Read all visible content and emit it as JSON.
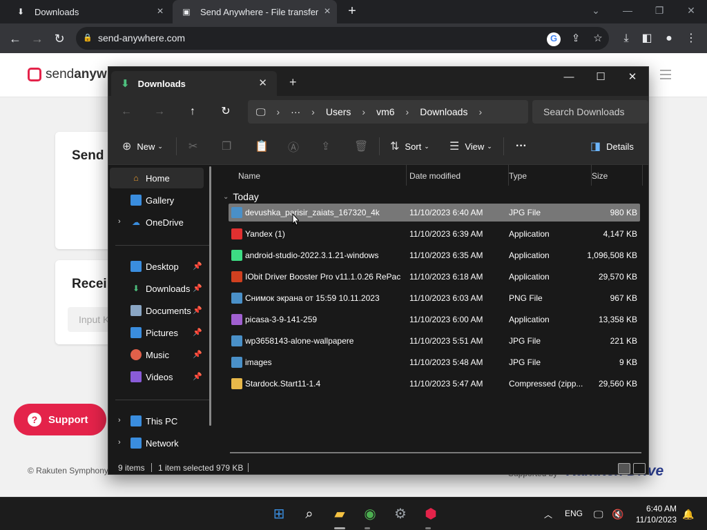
{
  "browser": {
    "tabs": [
      {
        "title": "Downloads",
        "icon": "download-icon"
      },
      {
        "title": "Send Anywhere - File transfer",
        "icon": "send-anywhere-favicon"
      }
    ],
    "url": "send-anywhere.com"
  },
  "site": {
    "logo_light": "send",
    "logo_bold": "anywhe",
    "send_title": "Send",
    "receive_title": "Recei",
    "input_placeholder": "Input K",
    "support_label": "Support",
    "copyright": "© Rakuten Symphony",
    "supported_by": "Supported by",
    "rakuten_brand": "Rakuten Drive",
    "brand_color": "#e4234a"
  },
  "explorer": {
    "tab_title": "Downloads",
    "path": [
      "Users",
      "vm6",
      "Downloads"
    ],
    "path_more": "···",
    "search_placeholder": "Search Downloads",
    "toolbar": {
      "new_label": "New",
      "sort_label": "Sort",
      "view_label": "View",
      "more_label": "···",
      "details_label": "Details"
    },
    "nav": {
      "home": "Home",
      "gallery": "Gallery",
      "onedrive": "OneDrive",
      "desktop": "Desktop",
      "downloads": "Downloads",
      "documents": "Documents",
      "pictures": "Pictures",
      "music": "Music",
      "videos": "Videos",
      "thispc": "This PC",
      "network": "Network"
    },
    "columns": {
      "name": "Name",
      "date": "Date modified",
      "type": "Type",
      "size": "Size"
    },
    "group": "Today",
    "files": [
      {
        "name": "devushka_parisir_zaiats_167320_4k",
        "date": "11/10/2023 6:40 AM",
        "type": "JPG File",
        "size": "980 KB",
        "icon": "image-file-icon",
        "selected": true
      },
      {
        "name": "Yandex (1)",
        "date": "11/10/2023 6:39 AM",
        "type": "Application",
        "size": "4,147 KB",
        "icon": "yandex-app-icon",
        "selected": false
      },
      {
        "name": "android-studio-2022.3.1.21-windows",
        "date": "11/10/2023 6:35 AM",
        "type": "Application",
        "size": "1,096,508 KB",
        "icon": "android-app-icon",
        "selected": false
      },
      {
        "name": "IObit Driver Booster Pro v11.1.0.26 RePac...",
        "date": "11/10/2023 6:18 AM",
        "type": "Application",
        "size": "29,570 KB",
        "icon": "driver-booster-app-icon",
        "selected": false
      },
      {
        "name": "Снимок экрана от 15:59  10.11.2023",
        "date": "11/10/2023 6:03 AM",
        "type": "PNG File",
        "size": "967 KB",
        "icon": "image-file-icon",
        "selected": false
      },
      {
        "name": "picasa-3-9-141-259",
        "date": "11/10/2023 6:00 AM",
        "type": "Application",
        "size": "13,358 KB",
        "icon": "picasa-app-icon",
        "selected": false
      },
      {
        "name": "wp3658143-alone-wallpapere",
        "date": "11/10/2023 5:51 AM",
        "type": "JPG File",
        "size": "221 KB",
        "icon": "image-file-icon",
        "selected": false
      },
      {
        "name": "images",
        "date": "11/10/2023 5:48 AM",
        "type": "JPG File",
        "size": "9 KB",
        "icon": "image-file-icon",
        "selected": false
      },
      {
        "name": "Stardock.Start11-1.4",
        "date": "11/10/2023 5:47 AM",
        "type": "Compressed (zipp...",
        "size": "29,560 KB",
        "icon": "zip-folder-icon",
        "selected": false
      }
    ],
    "status": {
      "count": "9 items",
      "selection": "1 item selected  979 KB"
    }
  },
  "taskbar": {
    "language": "ENG",
    "time": "6:40 AM",
    "date": "11/10/2023"
  }
}
